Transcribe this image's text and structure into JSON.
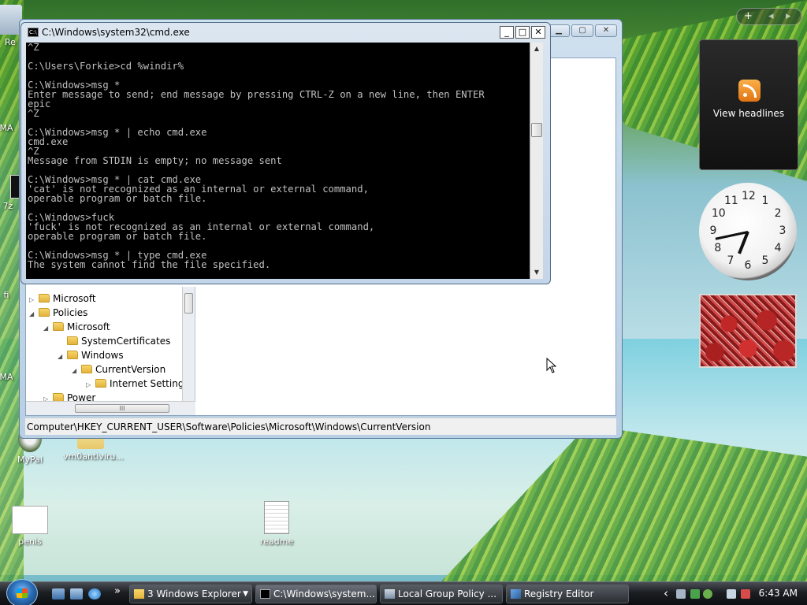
{
  "desktop": {
    "icons": [
      {
        "id": "recycle",
        "label": "Re"
      },
      {
        "id": "mas1",
        "label": "MA"
      },
      {
        "id": "zz",
        "label": "7z"
      },
      {
        "id": "fi",
        "label": "fi"
      },
      {
        "id": "mas2",
        "label": "MA"
      },
      {
        "id": "mypal",
        "label": "MyPal"
      },
      {
        "id": "vm0",
        "label": "vm0antiviru..."
      },
      {
        "id": "penis",
        "label": "penis"
      },
      {
        "id": "readme",
        "label": "readme"
      }
    ]
  },
  "cmd": {
    "title": "C:\\Windows\\system32\\cmd.exe",
    "controls": {
      "min": "_",
      "max": "□",
      "close": "✕"
    },
    "lines": [
      "^Z",
      "",
      "C:\\Users\\Forkie>cd %windir%",
      "",
      "C:\\Windows>msg *",
      "Enter message to send; end message by pressing CTRL-Z on a new line, then ENTER",
      "epic",
      "^Z",
      "",
      "C:\\Windows>msg * | echo cmd.exe",
      "cmd.exe",
      "^Z",
      "Message from STDIN is empty; no message sent",
      "",
      "C:\\Windows>msg * | cat cmd.exe",
      "'cat' is not recognized as an internal or external command,",
      "operable program or batch file.",
      "",
      "C:\\Windows>fuck",
      "'fuck' is not recognized as an internal or external command,",
      "operable program or batch file.",
      "",
      "C:\\Windows>msg * | type cmd.exe",
      "The system cannot find the file specified."
    ]
  },
  "registry": {
    "tree": [
      {
        "label": "Microsoft",
        "level": 0,
        "expander": "▷"
      },
      {
        "label": "Policies",
        "level": 0,
        "expander": "◢"
      },
      {
        "label": "Microsoft",
        "level": 1,
        "expander": "◢"
      },
      {
        "label": "SystemCertificates",
        "level": 2,
        "expander": ""
      },
      {
        "label": "Windows",
        "level": 2,
        "expander": "◢"
      },
      {
        "label": "CurrentVersion",
        "level": 3,
        "expander": "◢"
      },
      {
        "label": "Internet Settings",
        "level": 4,
        "expander": "▷"
      },
      {
        "label": "Power",
        "level": 1,
        "expander": "▷"
      }
    ],
    "hscroll_grip": "III",
    "status": "Computer\\HKEY_CURRENT_USER\\Software\\Policies\\Microsoft\\Windows\\CurrentVersion"
  },
  "sidebar": {
    "controls": {
      "add": "+",
      "prev": "◂",
      "next": "▸"
    },
    "feed_label": "View headlines",
    "clock_numbers": [
      "12",
      "1",
      "2",
      "3",
      "4",
      "5",
      "6",
      "7",
      "8",
      "9",
      "10",
      "11"
    ],
    "clock_time": {
      "hours": 6,
      "minutes": 43
    }
  },
  "taskbar": {
    "buttons": [
      {
        "id": "explorer",
        "label": "3 Windows Explorer"
      },
      {
        "id": "cmd",
        "label": "C:\\Windows\\system..."
      },
      {
        "id": "gpedit",
        "label": "Local Group Policy ..."
      },
      {
        "id": "regedit",
        "label": "Registry Editor"
      }
    ],
    "quicklaunch_more": "»",
    "tray_more": "‹",
    "time": "6:43 AM"
  },
  "colors": {
    "cmd_bg": "#000000",
    "cmd_text": "#c0c0c0",
    "taskbar": "#1b1e22",
    "folder": "#e3b23c"
  }
}
